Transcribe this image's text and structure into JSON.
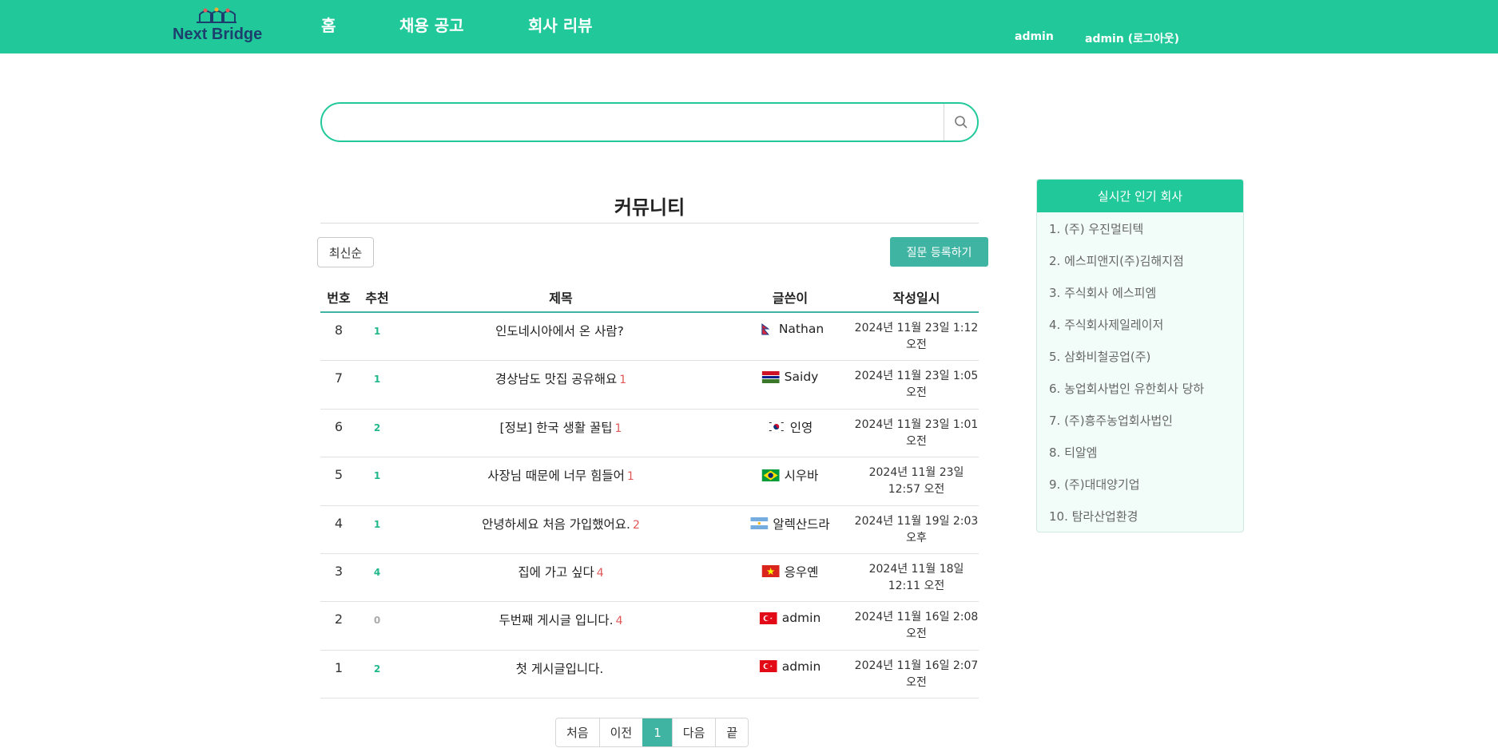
{
  "header": {
    "logo_text": "Next Bridge",
    "nav": [
      "홈",
      "채용 공고",
      "회사 리뷰"
    ],
    "user": "admin",
    "logout": "admin (로그아웃)"
  },
  "search": {
    "value": "",
    "placeholder": ""
  },
  "community": {
    "title": "커뮤니티",
    "sort_label": "최신순",
    "ask_label": "질문 등록하기",
    "columns": [
      "번호",
      "추천",
      "제목",
      "글쓴이",
      "작성일시"
    ],
    "posts": [
      {
        "num": "8",
        "rec": "1",
        "title": "인도네시아에서 온 사람?",
        "comments": "",
        "author": "Nathan",
        "flag": "nepal-flag-icon",
        "date": "2024년 11월 23일 1:12 오전"
      },
      {
        "num": "7",
        "rec": "1",
        "title": "경상남도 맛집 공유해요",
        "comments": "1",
        "author": "Saidy",
        "flag": "gambia-flag-icon",
        "date": "2024년 11월 23일 1:05 오전"
      },
      {
        "num": "6",
        "rec": "2",
        "title": "[정보] 한국 생활 꿀팁",
        "comments": "1",
        "author": "인영",
        "flag": "korea-flag-icon",
        "date": "2024년 11월 23일 1:01 오전"
      },
      {
        "num": "5",
        "rec": "1",
        "title": "사장님 때문에 너무 힘들어",
        "comments": "1",
        "author": "시우바",
        "flag": "brazil-flag-icon",
        "date": "2024년 11월 23일 12:57 오전"
      },
      {
        "num": "4",
        "rec": "1",
        "title": "안녕하세요 처음 가입했어요.",
        "comments": "2",
        "author": "알렉산드라",
        "flag": "argentina-flag-icon",
        "date": "2024년 11월 19일 2:03 오후"
      },
      {
        "num": "3",
        "rec": "4",
        "title": "집에 가고 싶다",
        "comments": "4",
        "author": "응우옌",
        "flag": "vietnam-flag-icon",
        "date": "2024년 11월 18일 12:11 오전"
      },
      {
        "num": "2",
        "rec": "0",
        "title": "두번째 게시글 입니다.",
        "comments": "4",
        "author": "admin",
        "flag": "turkey-flag-icon",
        "date": "2024년 11월 16일 2:08 오전"
      },
      {
        "num": "1",
        "rec": "2",
        "title": "첫 게시글입니다.",
        "comments": "",
        "author": "admin",
        "flag": "turkey-flag-icon",
        "date": "2024년 11월 16일 2:07 오전"
      }
    ]
  },
  "pagination": [
    "처음",
    "이전",
    "1",
    "다음",
    "끝"
  ],
  "popular": {
    "title": "실시간 인기 회사",
    "items": [
      "1. (주) 우진멀티텍",
      "2. 에스피앤지(주)김해지점",
      "3. 주식회사 에스피엠",
      "4. 주식회사제일레이저",
      "5. 삼화비철공업(주)",
      "6. 농업회사법인 유한회사 당하",
      "7. (주)흥주농업회사법인",
      "8. 티알엠",
      "9. (주)대대양기업",
      "10. 탐라산업환경"
    ]
  },
  "colors": {
    "brand": "#21c99a",
    "accent": "#3fb4a3",
    "comment": "#e05858",
    "recommend": "#21b88c",
    "recommend_zero": "#aaaaaa"
  }
}
